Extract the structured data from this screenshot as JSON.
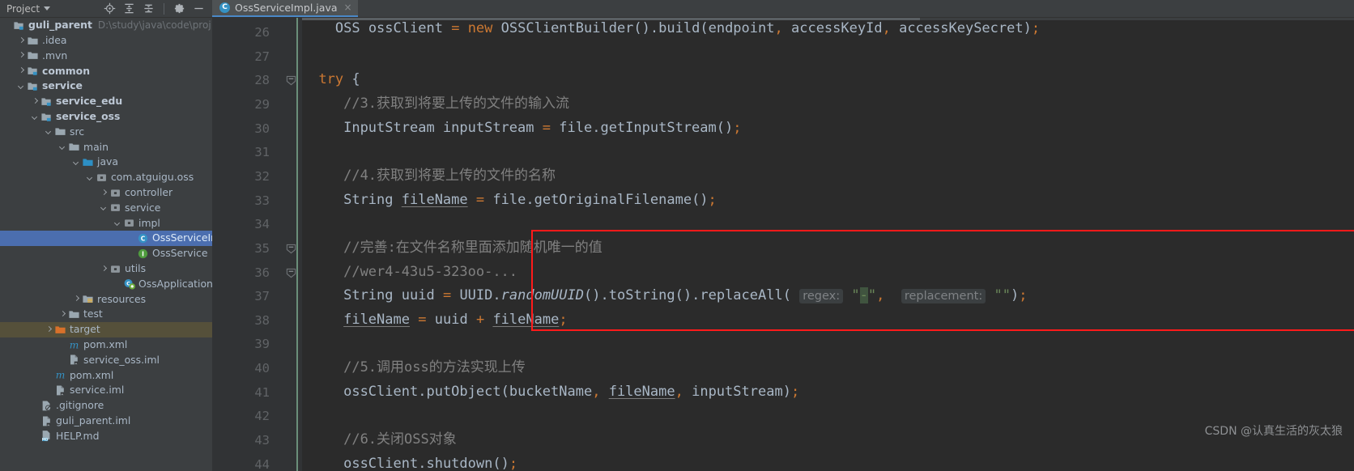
{
  "toolwindow": {
    "title": "Project",
    "caret_icon": "chevron-down-icon",
    "actions": [
      {
        "name": "locate-icon",
        "label": "Select Opened File"
      },
      {
        "name": "expand-all-icon",
        "label": "Expand All"
      },
      {
        "name": "collapse-all-icon",
        "label": "Collapse All"
      },
      {
        "name": "gear-icon",
        "label": "Settings"
      },
      {
        "name": "minimize-icon",
        "label": "Hide"
      }
    ]
  },
  "tabs": [
    {
      "label": "OssServiceImpl.java",
      "icon": "java-class-icon",
      "icon_letter": "C",
      "close_label": "×",
      "active": true
    }
  ],
  "tree": [
    {
      "depth": 0,
      "arrow": "none",
      "icon": "module-icon",
      "label": "guli_parent",
      "bold": true,
      "path": "D:\\study\\java\\code\\project\\guli_"
    },
    {
      "depth": 1,
      "arrow": "right",
      "icon": "folder-icon",
      "label": ".idea"
    },
    {
      "depth": 1,
      "arrow": "right",
      "icon": "folder-icon",
      "label": ".mvn"
    },
    {
      "depth": 1,
      "arrow": "right",
      "icon": "module-icon",
      "label": "common",
      "bold": true
    },
    {
      "depth": 1,
      "arrow": "down",
      "icon": "module-icon",
      "label": "service",
      "bold": true
    },
    {
      "depth": 2,
      "arrow": "right",
      "icon": "module-icon",
      "label": "service_edu",
      "bold": true
    },
    {
      "depth": 2,
      "arrow": "down",
      "icon": "module-icon",
      "label": "service_oss",
      "bold": true
    },
    {
      "depth": 3,
      "arrow": "down",
      "icon": "folder-icon",
      "label": "src"
    },
    {
      "depth": 4,
      "arrow": "down",
      "icon": "folder-icon",
      "label": "main"
    },
    {
      "depth": 5,
      "arrow": "down",
      "icon": "source-root-icon",
      "label": "java"
    },
    {
      "depth": 6,
      "arrow": "down",
      "icon": "package-icon",
      "label": "com.atguigu.oss"
    },
    {
      "depth": 7,
      "arrow": "right",
      "icon": "package-icon",
      "label": "controller"
    },
    {
      "depth": 7,
      "arrow": "down",
      "icon": "package-icon",
      "label": "service"
    },
    {
      "depth": 8,
      "arrow": "down",
      "icon": "package-icon",
      "label": "impl"
    },
    {
      "depth": 9,
      "arrow": "none",
      "icon": "java-class-icon",
      "label": "OssServiceImpl",
      "selected": true
    },
    {
      "depth": 9,
      "arrow": "none",
      "icon": "java-interface-icon",
      "label": "OssService"
    },
    {
      "depth": 7,
      "arrow": "right",
      "icon": "package-icon",
      "label": "utils"
    },
    {
      "depth": 8,
      "arrow": "none",
      "icon": "spring-class-icon",
      "label": "OssApplication"
    },
    {
      "depth": 5,
      "arrow": "right",
      "icon": "resources-icon",
      "label": "resources"
    },
    {
      "depth": 4,
      "arrow": "right",
      "icon": "folder-icon",
      "label": "test"
    },
    {
      "depth": 3,
      "arrow": "right",
      "icon": "target-folder-icon",
      "label": "target",
      "highlight": true
    },
    {
      "depth": 4,
      "arrow": "none",
      "icon": "maven-icon",
      "label": "pom.xml"
    },
    {
      "depth": 4,
      "arrow": "none",
      "icon": "iml-icon",
      "label": "service_oss.iml"
    },
    {
      "depth": 3,
      "arrow": "none",
      "icon": "maven-icon",
      "label": "pom.xml"
    },
    {
      "depth": 3,
      "arrow": "none",
      "icon": "iml-icon",
      "label": "service.iml"
    },
    {
      "depth": 2,
      "arrow": "none",
      "icon": "gitignore-icon",
      "label": ".gitignore"
    },
    {
      "depth": 2,
      "arrow": "none",
      "icon": "iml-icon",
      "label": "guli_parent.iml"
    },
    {
      "depth": 2,
      "arrow": "none",
      "icon": "markdown-icon",
      "label": "HELP.md"
    }
  ],
  "editor": {
    "first_line_number": 26,
    "line_numbers": [
      26,
      27,
      28,
      29,
      30,
      31,
      32,
      33,
      34,
      35,
      36,
      37,
      38,
      39,
      40,
      41,
      42,
      43,
      44
    ],
    "fold_markers": [
      "line-28-fold",
      "line-35-fold",
      "line-36-fold"
    ],
    "lines": {
      "l26": "OSS ossClient = new OSSClientBuilder().build(endpoint, accessKeyId, accessKeySecret);",
      "l27": "",
      "l28": "try {",
      "l29_comment": "//3.获取到将要上传的文件的输入流",
      "l30": "InputStream inputStream = file.getInputStream();",
      "l31": "",
      "l32_comment": "//4.获取到将要上传的文件的名称",
      "l33": "String fileName = file.getOriginalFilename();",
      "l34": "",
      "l35_comment": "//完善:在文件名称里面添加随机唯一的值",
      "l36_comment": "//wer4-43u5-323oo-...",
      "l37": "String uuid = UUID.randomUUID().toString().replaceAll( regex: \"-\",  replacement: \"\");",
      "l38": "fileName = uuid + fileName;",
      "l39": "",
      "l40_comment": "//5.调用oss的方法实现上传",
      "l41": "ossClient.putObject(bucketName, fileName, inputStream);",
      "l42": "",
      "l43_comment": "//6.关闭OSS对象",
      "l44": "ossClient.shutdown();"
    },
    "tokens": {
      "kw_new": "new",
      "kw_try": "try",
      "type_oss": "OSS",
      "type_inputstream": "InputStream",
      "type_string": "String",
      "type_uuid": "UUID",
      "hint_regex": "regex:",
      "hint_replacement": "replacement:",
      "str_dash": "\"-\"",
      "str_empty": "\"\""
    },
    "highlight_box": {
      "name": "red-annotation-box",
      "color": "#ff1a1a"
    }
  },
  "watermark": "CSDN @认真生活的灰太狼",
  "colors": {
    "editor_bg": "#2b2b2b",
    "panel_bg": "#3c3f41",
    "gutter_bg": "#313335",
    "selection_blue": "#4b6eaf",
    "accent_blue": "#4a88c7",
    "keyword_orange": "#cc7832",
    "string_green": "#6a8759",
    "comment_gray": "#808080",
    "text_default": "#a9b7c6",
    "red_box": "#ff1a1a",
    "modified_stripe": "#6b8f7a"
  }
}
